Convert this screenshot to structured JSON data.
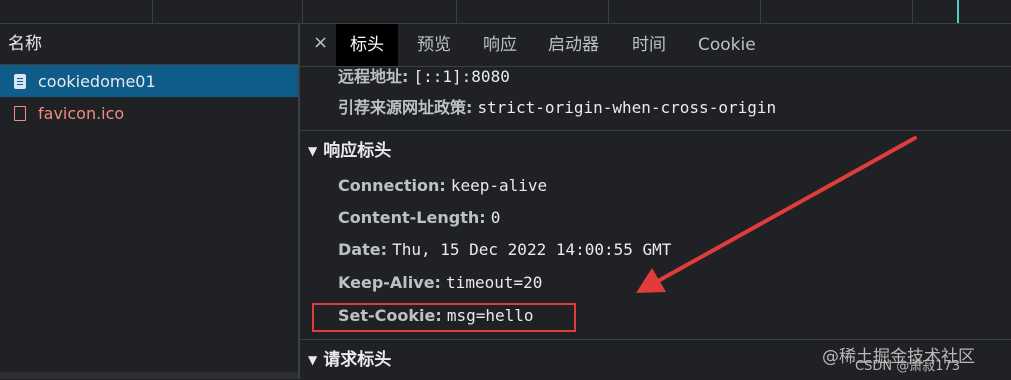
{
  "list_header": "名称",
  "requests": [
    {
      "name": "cookiedome01"
    },
    {
      "name": "favicon.ico"
    }
  ],
  "tabs": [
    "标头",
    "预览",
    "响应",
    "启动器",
    "时间",
    "Cookie"
  ],
  "close_glyph": "×",
  "general": [
    {
      "key": "远程地址:",
      "value": "[::1]:8080"
    },
    {
      "key": "引荐来源网址政策:",
      "value": "strict-origin-when-cross-origin"
    }
  ],
  "response_headers": {
    "title": "响应标头",
    "items": [
      {
        "key": "Connection:",
        "value": "keep-alive"
      },
      {
        "key": "Content-Length:",
        "value": "0"
      },
      {
        "key": "Date:",
        "value": "Thu, 15 Dec 2022 14:00:55 GMT"
      },
      {
        "key": "Keep-Alive:",
        "value": "timeout=20"
      },
      {
        "key": "Set-Cookie:",
        "value": "msg=hello"
      }
    ]
  },
  "request_headers": {
    "title": "请求标头"
  },
  "watermarks": [
    "@稀土掘金技术社区",
    "CSDN @萧寂173"
  ],
  "colors": {
    "selected": "#0f5b8a",
    "error": "#f28b82",
    "annotation": "#e03c3c"
  }
}
